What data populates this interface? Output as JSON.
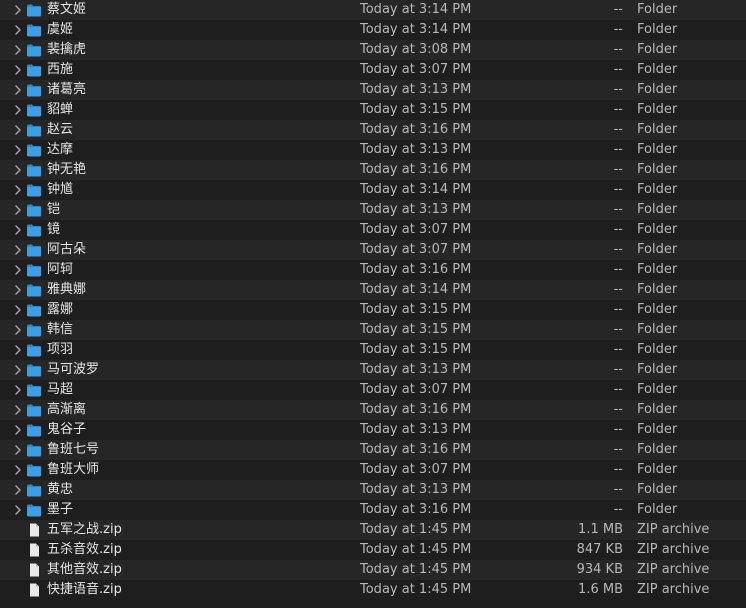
{
  "colors": {
    "background": "#1e1e1e",
    "alt_row": "#262626",
    "folder_blue": "#3aa0e6",
    "text": "#e6e6e6",
    "secondary_text": "#b8b8b8"
  },
  "items": [
    {
      "name": "蔡文姬",
      "date": "Today at 3:14 PM",
      "size": "--",
      "kind": "Folder",
      "icon": "folder-icon"
    },
    {
      "name": "虞姬",
      "date": "Today at 3:14 PM",
      "size": "--",
      "kind": "Folder",
      "icon": "folder-icon"
    },
    {
      "name": "裴擒虎",
      "date": "Today at 3:08 PM",
      "size": "--",
      "kind": "Folder",
      "icon": "folder-icon"
    },
    {
      "name": "西施",
      "date": "Today at 3:07 PM",
      "size": "--",
      "kind": "Folder",
      "icon": "folder-icon"
    },
    {
      "name": "诸葛亮",
      "date": "Today at 3:13 PM",
      "size": "--",
      "kind": "Folder",
      "icon": "folder-icon"
    },
    {
      "name": "貂蝉",
      "date": "Today at 3:15 PM",
      "size": "--",
      "kind": "Folder",
      "icon": "folder-icon"
    },
    {
      "name": "赵云",
      "date": "Today at 3:16 PM",
      "size": "--",
      "kind": "Folder",
      "icon": "folder-icon"
    },
    {
      "name": "达摩",
      "date": "Today at 3:13 PM",
      "size": "--",
      "kind": "Folder",
      "icon": "folder-icon"
    },
    {
      "name": "钟无艳",
      "date": "Today at 3:16 PM",
      "size": "--",
      "kind": "Folder",
      "icon": "folder-icon"
    },
    {
      "name": "钟馗",
      "date": "Today at 3:14 PM",
      "size": "--",
      "kind": "Folder",
      "icon": "folder-icon"
    },
    {
      "name": "铠",
      "date": "Today at 3:13 PM",
      "size": "--",
      "kind": "Folder",
      "icon": "folder-icon"
    },
    {
      "name": "镜",
      "date": "Today at 3:07 PM",
      "size": "--",
      "kind": "Folder",
      "icon": "folder-icon"
    },
    {
      "name": "阿古朵",
      "date": "Today at 3:07 PM",
      "size": "--",
      "kind": "Folder",
      "icon": "folder-icon"
    },
    {
      "name": "阿轲",
      "date": "Today at 3:16 PM",
      "size": "--",
      "kind": "Folder",
      "icon": "folder-icon"
    },
    {
      "name": "雅典娜",
      "date": "Today at 3:14 PM",
      "size": "--",
      "kind": "Folder",
      "icon": "folder-icon"
    },
    {
      "name": "露娜",
      "date": "Today at 3:15 PM",
      "size": "--",
      "kind": "Folder",
      "icon": "folder-icon"
    },
    {
      "name": "韩信",
      "date": "Today at 3:15 PM",
      "size": "--",
      "kind": "Folder",
      "icon": "folder-icon"
    },
    {
      "name": "项羽",
      "date": "Today at 3:15 PM",
      "size": "--",
      "kind": "Folder",
      "icon": "folder-icon"
    },
    {
      "name": "马可波罗",
      "date": "Today at 3:13 PM",
      "size": "--",
      "kind": "Folder",
      "icon": "folder-icon"
    },
    {
      "name": "马超",
      "date": "Today at 3:07 PM",
      "size": "--",
      "kind": "Folder",
      "icon": "folder-icon"
    },
    {
      "name": "高渐离",
      "date": "Today at 3:16 PM",
      "size": "--",
      "kind": "Folder",
      "icon": "folder-icon"
    },
    {
      "name": "鬼谷子",
      "date": "Today at 3:13 PM",
      "size": "--",
      "kind": "Folder",
      "icon": "folder-icon"
    },
    {
      "name": "鲁班七号",
      "date": "Today at 3:16 PM",
      "size": "--",
      "kind": "Folder",
      "icon": "folder-icon"
    },
    {
      "name": "鲁班大师",
      "date": "Today at 3:07 PM",
      "size": "--",
      "kind": "Folder",
      "icon": "folder-icon"
    },
    {
      "name": "黄忠",
      "date": "Today at 3:13 PM",
      "size": "--",
      "kind": "Folder",
      "icon": "folder-icon"
    },
    {
      "name": "墨子",
      "date": "Today at 3:16 PM",
      "size": "--",
      "kind": "Folder",
      "icon": "folder-icon"
    },
    {
      "name": "五军之战.zip",
      "date": "Today at 1:45 PM",
      "size": "1.1 MB",
      "kind": "ZIP archive",
      "icon": "document-icon"
    },
    {
      "name": "五杀音效.zip",
      "date": "Today at 1:45 PM",
      "size": "847 KB",
      "kind": "ZIP archive",
      "icon": "document-icon"
    },
    {
      "name": "其他音效.zip",
      "date": "Today at 1:45 PM",
      "size": "934 KB",
      "kind": "ZIP archive",
      "icon": "document-icon"
    },
    {
      "name": "快捷语音.zip",
      "date": "Today at 1:45 PM",
      "size": "1.6 MB",
      "kind": "ZIP archive",
      "icon": "document-icon"
    }
  ]
}
